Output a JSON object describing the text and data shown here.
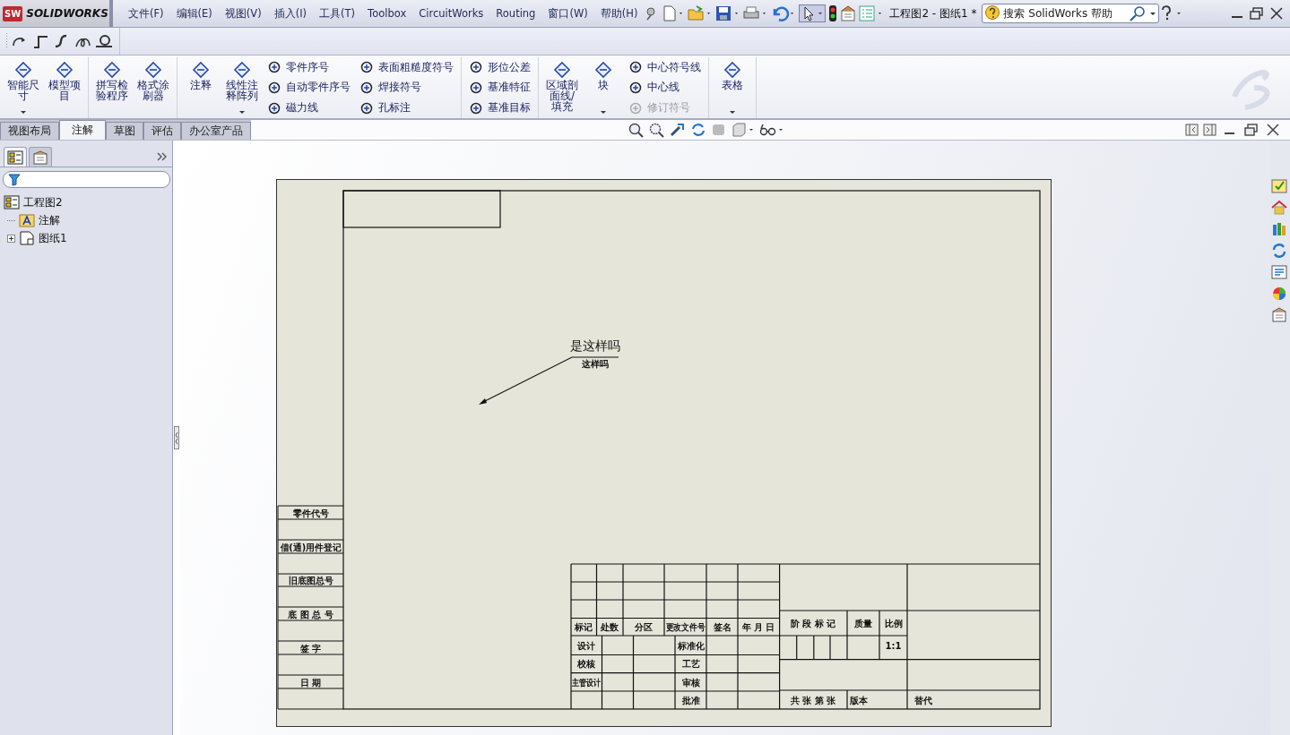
{
  "logo": {
    "mark": "SW",
    "name": "SOLIDWORKS"
  },
  "menu": [
    {
      "label": "文件(F)"
    },
    {
      "label": "编辑(E)"
    },
    {
      "label": "视图(V)"
    },
    {
      "label": "插入(I)"
    },
    {
      "label": "工具(T)"
    },
    {
      "label": "Toolbox"
    },
    {
      "label": "CircuitWorks"
    },
    {
      "label": "Routing"
    },
    {
      "label": "窗口(W)"
    },
    {
      "label": "帮助(H)"
    }
  ],
  "document_title": "工程图2 - 图纸1 *",
  "help_search": {
    "placeholder": "搜索 SolidWorks 帮助"
  },
  "ribbon": [
    {
      "tools": [
        {
          "kind": "large",
          "label": "智能尺寸",
          "dropdown": true,
          "disabled": false
        },
        {
          "kind": "large",
          "label": "模型项目",
          "dropdown": false,
          "disabled": false
        }
      ]
    },
    {
      "tools": [
        {
          "kind": "large",
          "label": "拼写检验程序",
          "dropdown": false,
          "disabled": false
        },
        {
          "kind": "large",
          "label": "格式涂刷器",
          "dropdown": false,
          "disabled": false
        }
      ]
    },
    {
      "tools": [
        {
          "kind": "large",
          "label": "注释",
          "dropdown": false,
          "disabled": false
        },
        {
          "kind": "large",
          "label": "线性注释阵列",
          "dropdown": true,
          "disabled": false
        },
        {
          "kind": "small",
          "label": "零件序号",
          "disabled": false
        },
        {
          "kind": "small",
          "label": "自动零件序号",
          "disabled": false
        },
        {
          "kind": "small",
          "label": "磁力线",
          "disabled": false
        },
        {
          "kind": "small",
          "label": "表面粗糙度符号",
          "disabled": false
        },
        {
          "kind": "small",
          "label": "焊接符号",
          "disabled": false
        },
        {
          "kind": "small",
          "label": "孔标注",
          "disabled": false
        }
      ]
    },
    {
      "tools": [
        {
          "kind": "small",
          "label": "形位公差",
          "disabled": false
        },
        {
          "kind": "small",
          "label": "基准特征",
          "disabled": false
        },
        {
          "kind": "small",
          "label": "基准目标",
          "disabled": false
        }
      ]
    },
    {
      "tools": [
        {
          "kind": "large",
          "label": "区域剖面线/填充",
          "dropdown": false,
          "disabled": false
        },
        {
          "kind": "large",
          "label": "块",
          "dropdown": true,
          "disabled": false
        },
        {
          "kind": "small",
          "label": "中心符号线",
          "disabled": false
        },
        {
          "kind": "small",
          "label": "中心线",
          "disabled": false
        },
        {
          "kind": "small",
          "label": "修订符号",
          "disabled": true
        }
      ]
    },
    {
      "tools": [
        {
          "kind": "large",
          "label": "表格",
          "dropdown": true,
          "disabled": false
        }
      ]
    }
  ],
  "command_tabs": [
    {
      "label": "视图布局",
      "selected": false
    },
    {
      "label": "注解",
      "selected": true
    },
    {
      "label": "草图",
      "selected": false
    },
    {
      "label": "评估",
      "selected": false
    },
    {
      "label": "办公室产品",
      "selected": false
    }
  ],
  "panel_tabs": [
    {
      "selected": true
    },
    {
      "selected": false
    }
  ],
  "tree": {
    "label": "工程图2",
    "children": [
      {
        "label": "注解",
        "expandable": false
      },
      {
        "label": "图纸1",
        "expandable": true
      }
    ]
  },
  "sheet": {
    "side_labels": [
      "零件代号",
      "借(通)用件登记",
      "旧底图总号",
      "底 图 总 号",
      "签 字",
      "日 期"
    ],
    "title_block": [
      "标记",
      "处数",
      "分区",
      "更改文件号",
      "签名",
      "年 月 日",
      "阶 段 标 记",
      "质量",
      "比例",
      "设计",
      "标准化",
      "1:1",
      "校核",
      "工艺",
      "主管设计",
      "审核",
      "批准",
      "共 张 第 张",
      "版本",
      "替代"
    ],
    "note": {
      "text": "是这样吗",
      "subtext": "这样吗"
    }
  }
}
